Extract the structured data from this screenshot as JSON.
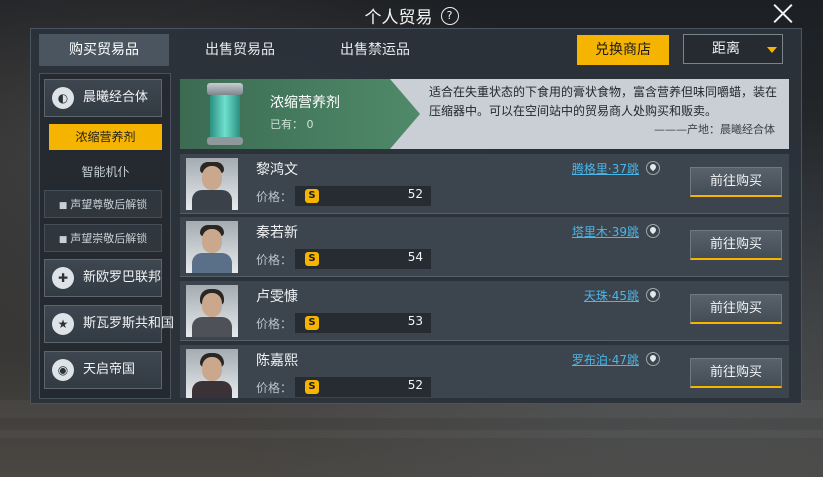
{
  "window": {
    "title": "个人贸易"
  },
  "tabs": [
    "购买贸易品",
    "出售贸易品",
    "出售禁运品"
  ],
  "exchange_shop": "兑换商店",
  "sort": {
    "selected": "距离"
  },
  "sidebar": {
    "factions": [
      "晨曦经合体",
      "新欧罗巴联邦",
      "斯瓦罗斯共和国",
      "天启帝国"
    ],
    "selected_item": "浓缩营养剂",
    "category": "智能机仆",
    "locked": [
      "声望尊敬后解锁",
      "声望崇敬后解锁"
    ]
  },
  "item": {
    "name": "浓缩营养剂",
    "owned": "已有： 0",
    "description": "适合在失重状态的下食用的膏状食物，富含营养但味同嚼蜡，装在压缩器中。可以在空间站中的贸易商人处购买和贩卖。",
    "origin": "———产地：晨曦经合体"
  },
  "price_label": "价格：",
  "buy_label": "前往购买",
  "currency_symbol": "S",
  "sellers": [
    {
      "name": "黎鸿文",
      "location": "腾格里·37跳",
      "price": "52"
    },
    {
      "name": "秦若新",
      "location": "塔里木·39跳",
      "price": "54"
    },
    {
      "name": "卢雯慷",
      "location": "天珠·45跳",
      "price": "53"
    },
    {
      "name": "陈嘉熙",
      "location": "罗布泊·47跳",
      "price": "52"
    }
  ],
  "colors": {
    "accent": "#f5b400",
    "link": "#4bb6e8",
    "panel": "#2b323a"
  }
}
